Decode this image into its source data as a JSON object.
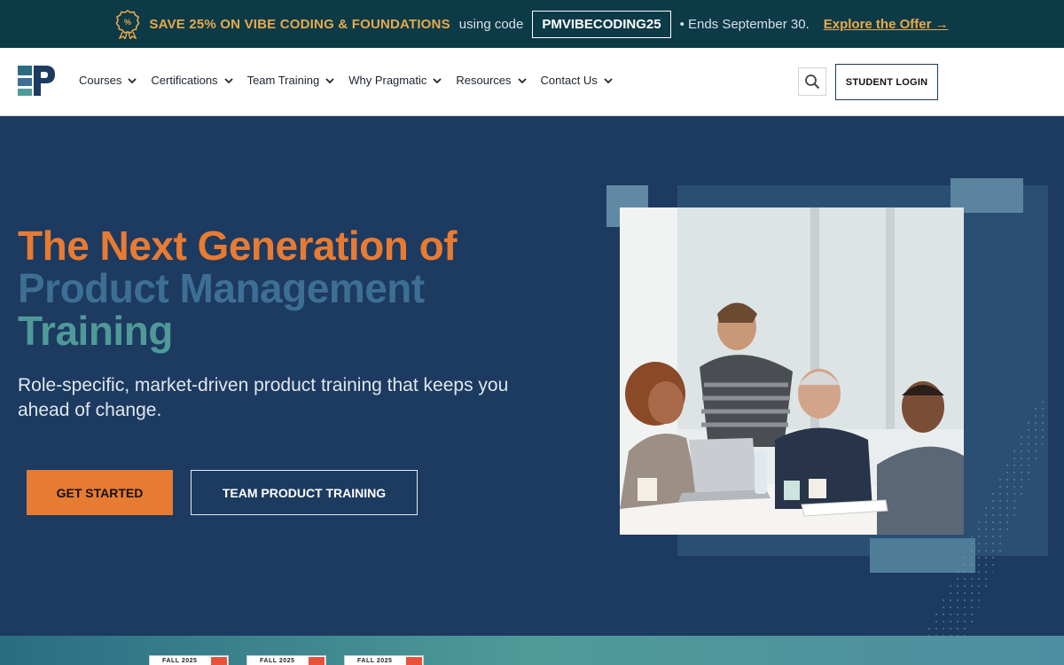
{
  "promo": {
    "headline": "SAVE 25% ON VIBE CODING & FOUNDATIONS",
    "using_text": "using code",
    "code": "PMVIBECODING25",
    "ends_text": "• Ends September 30.",
    "offer_link": "Explore the Offer →",
    "icon": "discount-badge-icon"
  },
  "header": {
    "logo_name": "pragmatic-logo",
    "nav": [
      {
        "label": "Courses"
      },
      {
        "label": "Certifications"
      },
      {
        "label": "Team Training"
      },
      {
        "label": "Why Pragmatic"
      },
      {
        "label": "Resources"
      },
      {
        "label": "Contact Us"
      }
    ],
    "search_icon": "search-icon",
    "login_label": "STUDENT LOGIN"
  },
  "hero": {
    "headline_line1": "The Next Generation of",
    "headline_line2": "Product Management",
    "headline_line3": "Training",
    "subtext": "Role-specific, market-driven product training that keeps you ahead of change.",
    "primary_button": "GET STARTED",
    "secondary_button": "TEAM PRODUCT TRAINING"
  },
  "badges": [
    {
      "label": "FALL 2025"
    },
    {
      "label": "FALL 2025"
    },
    {
      "label": "FALL 2025"
    }
  ],
  "colors": {
    "promo_bg": "#0c3a47",
    "promo_accent": "#e9a94a",
    "hero_bg": "#1d3a60",
    "orange": "#e87b32",
    "blue": "#3d6f95",
    "teal": "#4f9a99"
  }
}
